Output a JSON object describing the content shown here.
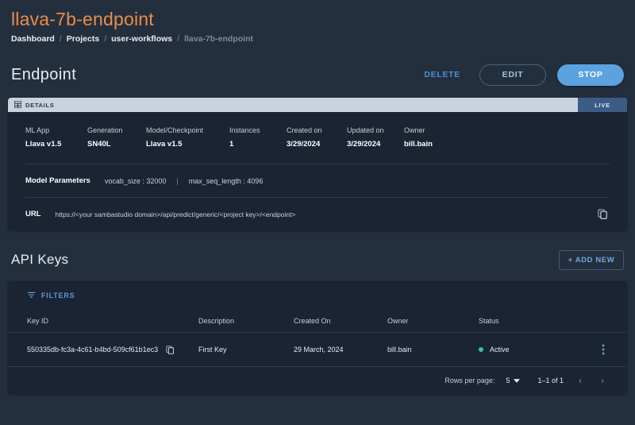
{
  "header": {
    "app_title": "llava-7b-endpoint",
    "breadcrumb": [
      {
        "label": "Dashboard"
      },
      {
        "label": "Projects"
      },
      {
        "label": "user-workflows"
      },
      {
        "label": "llava-7b-endpoint"
      }
    ],
    "separator": "/"
  },
  "title_row": {
    "page_title": "Endpoint",
    "delete_label": "DELETE",
    "edit_label": "EDIT",
    "stop_label": "STOP"
  },
  "details_card": {
    "tab_label": "DETAILS",
    "tab_icon": "grid-icon",
    "live_label": "LIVE",
    "specs": [
      {
        "label": "ML App",
        "value": "Llava v1.5"
      },
      {
        "label": "Generation",
        "value": "SN40L"
      },
      {
        "label": "Model/Checkpoint",
        "value": "Llava v1.5"
      },
      {
        "label": "Instances",
        "value": "1"
      },
      {
        "label": "Created on",
        "value": "3/29/2024"
      },
      {
        "label": "Updated on",
        "value": "3/29/2024"
      },
      {
        "label": "Owner",
        "value": "bill.bain"
      }
    ],
    "model_parameters": {
      "title": "Model Parameters",
      "vocab_size": "vocab_size : 32000",
      "separator": "|",
      "max_seq_length": "max_seq_length : 4096"
    },
    "url": {
      "label": "URL",
      "value": "https://<your sambastudio domain>/api/predict/generic/<project key>/<endpoint>",
      "copy_icon": "copy-icon"
    }
  },
  "api_keys": {
    "section_title": "API Keys",
    "add_new_label": "+ ADD NEW",
    "filters_label": "FILTERS",
    "filters_icon": "filter-icon",
    "columns": [
      "Key ID",
      "Description",
      "Created On",
      "Owner",
      "Status"
    ],
    "rows": [
      {
        "key_id": "550335db-fc3a-4c61-b4bd-509cf61b1ec3",
        "copy_icon": "copy-icon",
        "description": "First Key",
        "created_on": "29 March, 2024",
        "owner": "bill.bain",
        "status": "Active",
        "status_color": "#35c2b0",
        "menu_icon": "kebab-menu-icon"
      }
    ],
    "pagination": {
      "rows_per_page_label": "Rows per page:",
      "rows_per_page_value": "5",
      "range_label": "1–1 of 1",
      "prev_label": "‹",
      "next_label": "›"
    }
  },
  "colors": {
    "page_bg": "#242f3e",
    "card_bg": "#1b2433",
    "accent_orange": "#e98d4b",
    "accent_blue": "#5ba3e0",
    "tab_bg": "#c9d3de",
    "live_bg": "#3c5b87"
  }
}
